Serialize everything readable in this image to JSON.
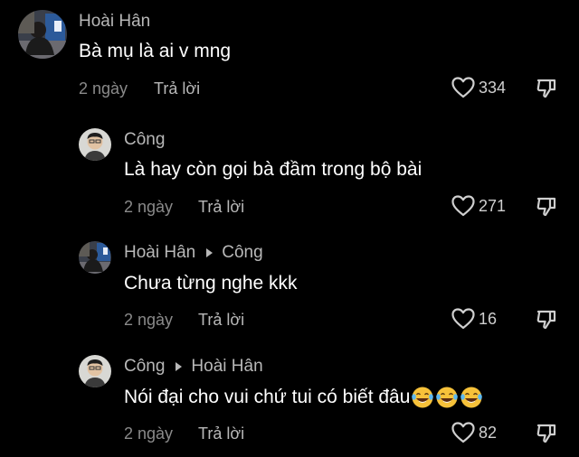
{
  "comments": [
    {
      "username": "Hoài Hân",
      "reply_to": "",
      "text": "Bà mụ là ai v mng",
      "time": "2 ngày",
      "reply_label": "Trả lời",
      "likes": "334"
    },
    {
      "username": "Công",
      "reply_to": "",
      "text": "Là hay còn gọi bà đầm trong bộ bài",
      "time": "2 ngày",
      "reply_label": "Trả lời",
      "likes": "271"
    },
    {
      "username": "Hoài Hân",
      "reply_to": "Công",
      "text": "Chưa từng nghe kkk",
      "time": "2 ngày",
      "reply_label": "Trả lời",
      "likes": "16"
    },
    {
      "username": "Công",
      "reply_to": "Hoài Hân",
      "text": "Nói đại cho vui chứ tui có biết đâu",
      "emojis": [
        "laughing-tears-emoji",
        "laughing-tears-emoji",
        "laughing-tears-emoji"
      ],
      "time": "2 ngày",
      "reply_label": "Trả lời",
      "likes": "82"
    }
  ],
  "colors": {
    "background": "#000000",
    "text": "#ffffff",
    "username": "#b8b8b8",
    "muted": "#8a8a8a"
  },
  "icons": [
    "heart-icon",
    "dislike-icon",
    "reply-arrow-icon"
  ]
}
